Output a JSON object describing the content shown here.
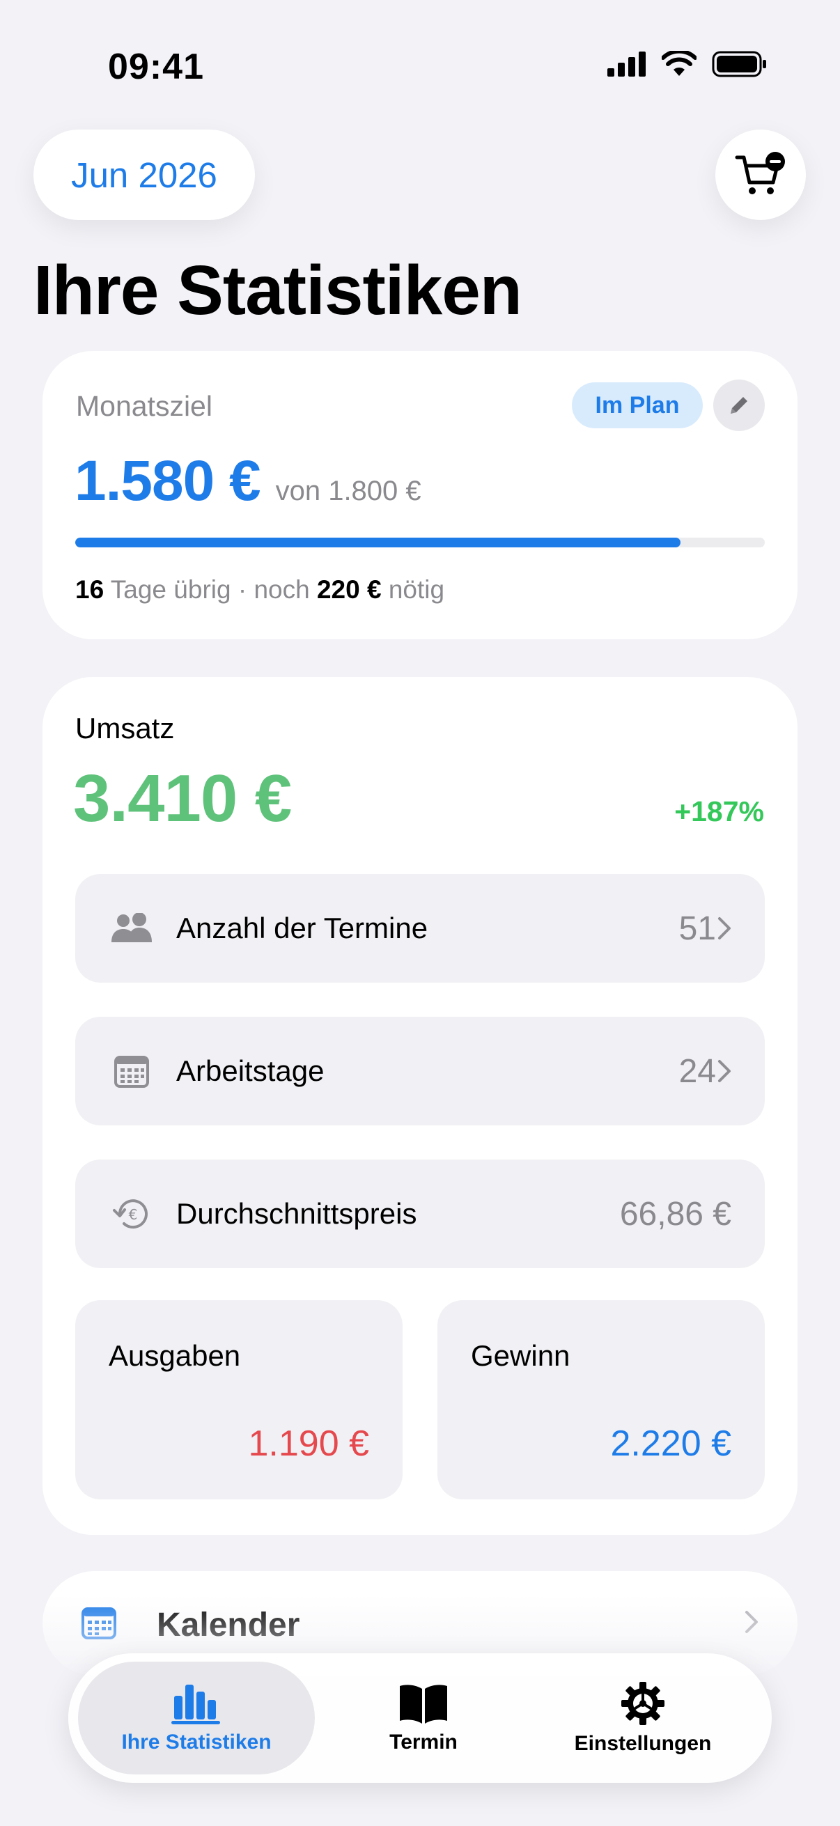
{
  "status_bar": {
    "time": "09:41"
  },
  "header": {
    "month_label": "Jun 2026",
    "title": "Ihre Statistiken"
  },
  "goal": {
    "label": "Monatsziel",
    "badge": "Im Plan",
    "amount": "1.580 €",
    "target": "von 1.800 €",
    "progress": 0.878,
    "days_left": "16",
    "days_text": "Tage übrig · noch",
    "needed": "220 €",
    "needed_text": "nötig"
  },
  "revenue": {
    "label": "Umsatz",
    "amount": "3.410 €",
    "change": "+187%",
    "stats": [
      {
        "label": "Anzahl der Termine",
        "value": "51",
        "icon": "people-icon"
      },
      {
        "label": "Arbeitstage",
        "value": "24",
        "icon": "calendar-grid-icon"
      },
      {
        "label": "Durchschnittspreis",
        "value": "66,86 €",
        "icon": "euro-history-icon"
      }
    ],
    "expenses": {
      "label": "Ausgaben",
      "value": "1.190 €"
    },
    "profit": {
      "label": "Gewinn",
      "value": "2.220 €"
    }
  },
  "calendar": {
    "label": "Kalender"
  },
  "tabs": [
    {
      "label": "Ihre Statistiken",
      "icon": "bar-chart-icon",
      "active": true
    },
    {
      "label": "Termin",
      "icon": "book-icon",
      "active": false
    },
    {
      "label": "Einstellungen",
      "icon": "gear-icon",
      "active": false
    }
  ],
  "colors": {
    "accent": "#1E7CE8",
    "revenue_green": "#5FC27A",
    "change_green": "#34C759",
    "expense_red": "#E5484D",
    "background": "#F2F2F7"
  }
}
